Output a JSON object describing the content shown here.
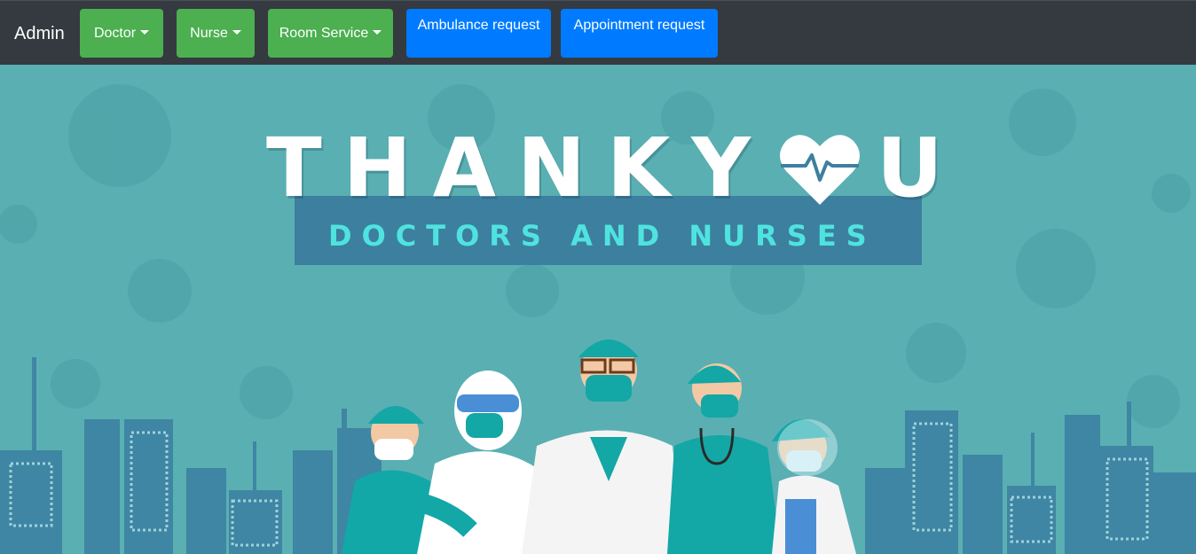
{
  "navbar": {
    "brand": "Admin",
    "menu": [
      {
        "label": "Doctor",
        "dropdown": true
      },
      {
        "label": "Nurse",
        "dropdown": true
      },
      {
        "label": "Room Service",
        "dropdown": true
      }
    ],
    "actions": [
      {
        "label": "Ambulance request"
      },
      {
        "label": "Appointment request"
      }
    ]
  },
  "hero": {
    "title_part": "THANKY",
    "title_end": "U",
    "title_icon": "heart-pulse-icon",
    "subtitle": "DOCTORS AND NURSES"
  },
  "colors": {
    "navbar_bg": "#343a40",
    "dropdown_button": "#4caf50",
    "action_button": "#007bff",
    "hero_bg": "#5aafb2",
    "ribbon": "#3d7f9e",
    "subtitle_text": "#4fe3e0"
  }
}
